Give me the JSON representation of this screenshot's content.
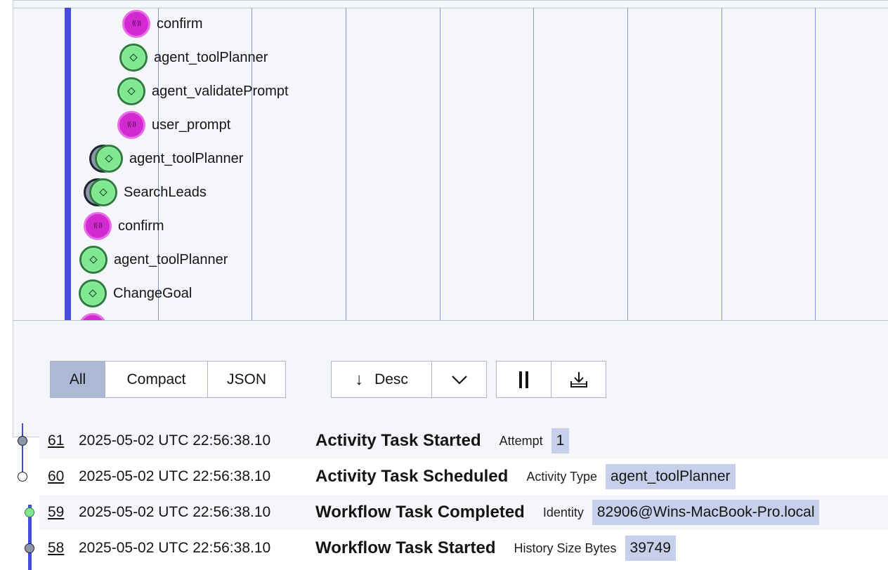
{
  "timeline": {
    "nodes": [
      {
        "label": "confirm",
        "kind": "signal",
        "icon": "signal-icon"
      },
      {
        "label": "agent_toolPlanner",
        "kind": "activity",
        "icon": "diamond-icon"
      },
      {
        "label": "agent_validatePrompt",
        "kind": "activity",
        "icon": "diamond-icon"
      },
      {
        "label": "user_prompt",
        "kind": "signal",
        "icon": "signal-icon"
      },
      {
        "label": "agent_toolPlanner",
        "kind": "activity",
        "icon": "diamond-icon"
      },
      {
        "label": "SearchLeads",
        "kind": "activity",
        "icon": "diamond-icon"
      },
      {
        "label": "confirm",
        "kind": "signal",
        "icon": "signal-icon"
      },
      {
        "label": "agent_toolPlanner",
        "kind": "activity",
        "icon": "diamond-icon"
      },
      {
        "label": "ChangeGoal",
        "kind": "activity",
        "icon": "diamond-icon"
      }
    ],
    "signal_glyph": "((·))"
  },
  "controls": {
    "view_all": "All",
    "view_compact": "Compact",
    "view_json": "JSON",
    "sort_label": "Desc",
    "sort_arrow": "↓",
    "dropdown_icon": "chevron-down-icon",
    "pause_icon": "pause-icon",
    "download_icon": "download-icon"
  },
  "events": [
    {
      "id": "61",
      "time": "2025-05-02 UTC 22:56:38.10",
      "name": "Activity Task Started",
      "key": "Attempt",
      "value": "1",
      "dot": "grey"
    },
    {
      "id": "60",
      "time": "2025-05-02 UTC 22:56:38.10",
      "name": "Activity Task Scheduled",
      "key": "Activity Type",
      "value": "agent_toolPlanner",
      "dot": "open"
    },
    {
      "id": "59",
      "time": "2025-05-02 UTC 22:56:38.10",
      "name": "Workflow Task Completed",
      "key": "Identity",
      "value": "82906@Wins-MacBook-Pro.local",
      "dot": "green"
    },
    {
      "id": "58",
      "time": "2025-05-02 UTC 22:56:38.10",
      "name": "Workflow Task Started",
      "key": "History Size Bytes",
      "value": "39749",
      "dot": "grey"
    }
  ],
  "colors": {
    "accent": "#444ce0",
    "activity_green": "#7ee78f",
    "signal_magenta": "#d229d0",
    "selected_tab": "#adb8d5",
    "value_chip": "#c6d0ea"
  }
}
